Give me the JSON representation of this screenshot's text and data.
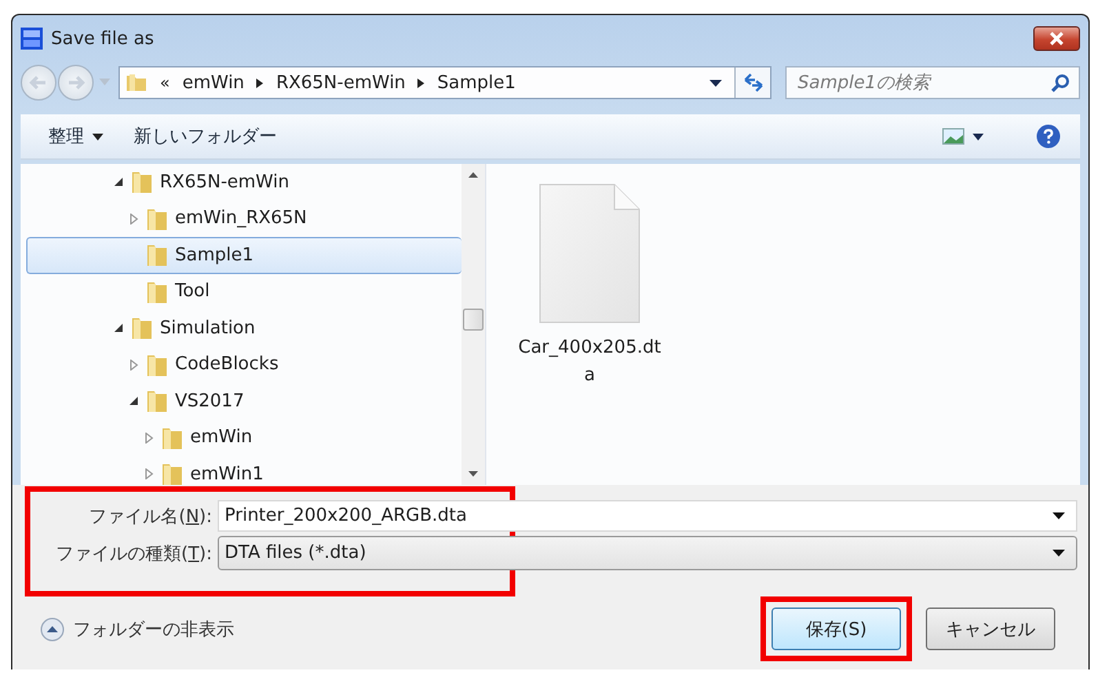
{
  "window": {
    "title": "Save file as"
  },
  "address": {
    "overflow": "«",
    "crumbs": [
      "emWin",
      "RX65N-emWin",
      "Sample1"
    ]
  },
  "search": {
    "placeholder": "Sample1の検索"
  },
  "toolbar": {
    "organize": "整理",
    "new_folder": "新しいフォルダー"
  },
  "tree": [
    {
      "label": "RX65N-emWin",
      "expandable": true,
      "expanded": true,
      "selected": false,
      "children": [
        {
          "label": "emWin_RX65N",
          "expandable": true,
          "expanded": false,
          "selected": false
        },
        {
          "label": "Sample1",
          "expandable": false,
          "selected": true
        },
        {
          "label": "Tool",
          "expandable": false,
          "selected": false
        }
      ]
    },
    {
      "label": "Simulation",
      "expandable": true,
      "expanded": true,
      "selected": false,
      "children": [
        {
          "label": "CodeBlocks",
          "expandable": true,
          "expanded": false,
          "selected": false
        },
        {
          "label": "VS2017",
          "expandable": true,
          "expanded": true,
          "selected": false,
          "children": [
            {
              "label": "emWin",
              "expandable": true,
              "expanded": false,
              "selected": false
            },
            {
              "label": "emWin1",
              "expandable": true,
              "expanded": false,
              "selected": false
            }
          ]
        }
      ]
    }
  ],
  "files": [
    {
      "name": "Car_400x205.dt",
      "name_wrap": "a"
    }
  ],
  "form": {
    "highlighted": true,
    "fields": [
      {
        "kind": "combo",
        "before": "ファイル名(",
        "key": "N",
        "after": "):",
        "value": "Printer_200x200_ARGB.dta"
      },
      {
        "kind": "dropdown",
        "before": "ファイルの種類(",
        "key": "T",
        "after": "):",
        "value": "DTA files (*.dta)"
      }
    ]
  },
  "hide_folders": "フォルダーの非表示",
  "buttons": [
    {
      "label": "保存(S)",
      "kind": "primary",
      "highlighted": true
    },
    {
      "label": "キャンセル",
      "kind": "normal",
      "highlighted": false
    }
  ]
}
